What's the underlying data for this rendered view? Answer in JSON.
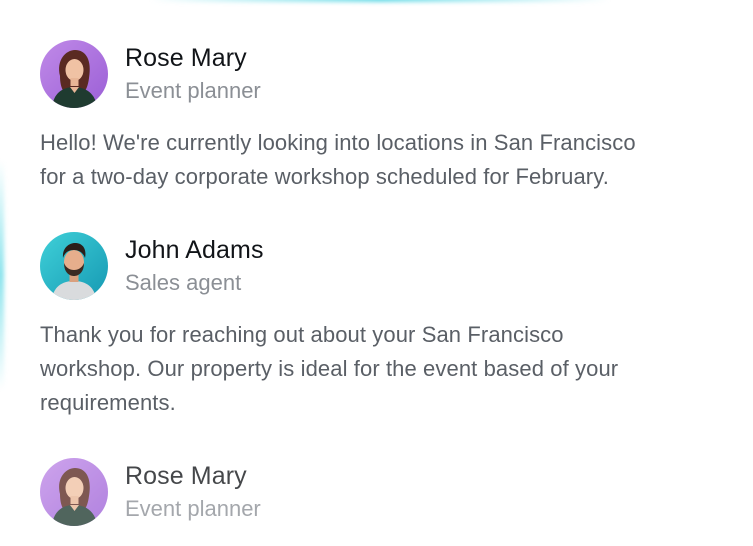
{
  "accent_color": "#5ad7e4",
  "messages": [
    {
      "name": "Rose Mary",
      "role": "Event planner",
      "avatar_icon": "woman-avatar-purple",
      "text_line1": "Hello! We're currently looking into locations in San Francisco",
      "text_line2": "for a two-day corporate workshop scheduled for February."
    },
    {
      "name": "John Adams",
      "role": "Sales agent",
      "avatar_icon": "man-avatar-teal",
      "text_line1": "Thank you for reaching out about your San Francisco",
      "text_line2": "workshop. Our property is ideal for the event based of your",
      "text_line3": "requirements."
    },
    {
      "name": "Rose Mary",
      "role": "Event planner",
      "avatar_icon": "woman-avatar-purple"
    }
  ]
}
